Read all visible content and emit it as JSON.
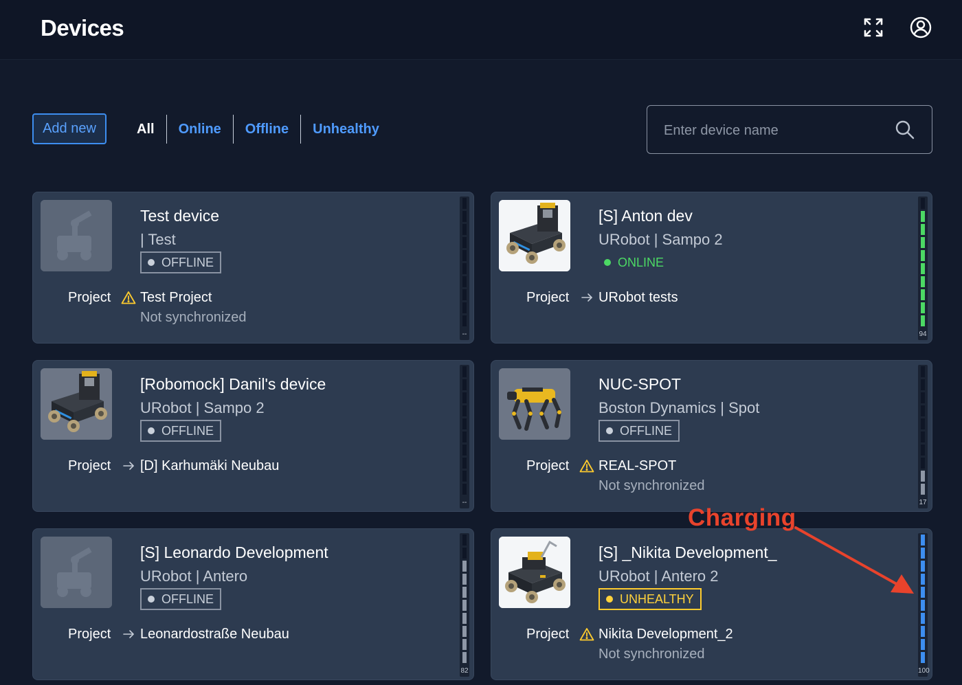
{
  "header": {
    "title": "Devices",
    "fullscreen_icon": "fullscreen-icon",
    "account_icon": "account-icon"
  },
  "toolbar": {
    "add_new_label": "Add new"
  },
  "filters": [
    {
      "label": "All",
      "active": true
    },
    {
      "label": "Online",
      "active": false
    },
    {
      "label": "Offline",
      "active": false
    },
    {
      "label": "Unhealthy",
      "active": false
    }
  ],
  "search": {
    "placeholder": "Enter device name",
    "value": ""
  },
  "project_label": "Project",
  "colors": {
    "accent": "#3d8ef0",
    "online": "#4cd964",
    "unhealthy": "#ffd23c",
    "battery_green": "#4cd964",
    "battery_blue": "#3d8ef0",
    "battery_gray": "#8e97a6",
    "annotation": "#e8432c"
  },
  "devices": [
    {
      "name": "Test device",
      "model": "| Test",
      "status": "OFFLINE",
      "project_icon": "warning-icon",
      "project_name": "Test Project",
      "sync": "Not synchronized",
      "battery_label": "--",
      "image": "placeholder-robot"
    },
    {
      "name": "[S] Anton dev",
      "model": "URobot | Sampo 2",
      "status": "ONLINE",
      "project_icon": "arrow-right-icon",
      "project_name": "URobot tests",
      "sync": "",
      "battery_label": "94",
      "image": "mobile-robot"
    },
    {
      "name": "[Robomock] Danil's device",
      "model": "URobot | Sampo 2",
      "status": "OFFLINE",
      "project_icon": "arrow-right-icon",
      "project_name": "[D] Karhumäki Neubau",
      "sync": "",
      "battery_label": "--",
      "image": "mobile-robot"
    },
    {
      "name": "NUC-SPOT",
      "model": "Boston Dynamics | Spot",
      "status": "OFFLINE",
      "project_icon": "warning-icon",
      "project_name": "REAL-SPOT",
      "sync": "Not synchronized",
      "battery_label": "17",
      "image": "robot-dog"
    },
    {
      "name": "[S] Leonardo Development",
      "model": "URobot | Antero",
      "status": "OFFLINE",
      "project_icon": "arrow-right-icon",
      "project_name": "Leonardostraße Neubau",
      "sync": "",
      "battery_label": "82",
      "image": "placeholder-robot"
    },
    {
      "name": "[S] _Nikita Development_",
      "model": "URobot | Antero 2",
      "status": "UNHEALTHY",
      "project_icon": "warning-icon",
      "project_name": "Nikita Development_2",
      "sync": "Not synchronized",
      "battery_label": "100",
      "image": "antero-robot"
    }
  ],
  "annotation": {
    "text": "Charging"
  }
}
